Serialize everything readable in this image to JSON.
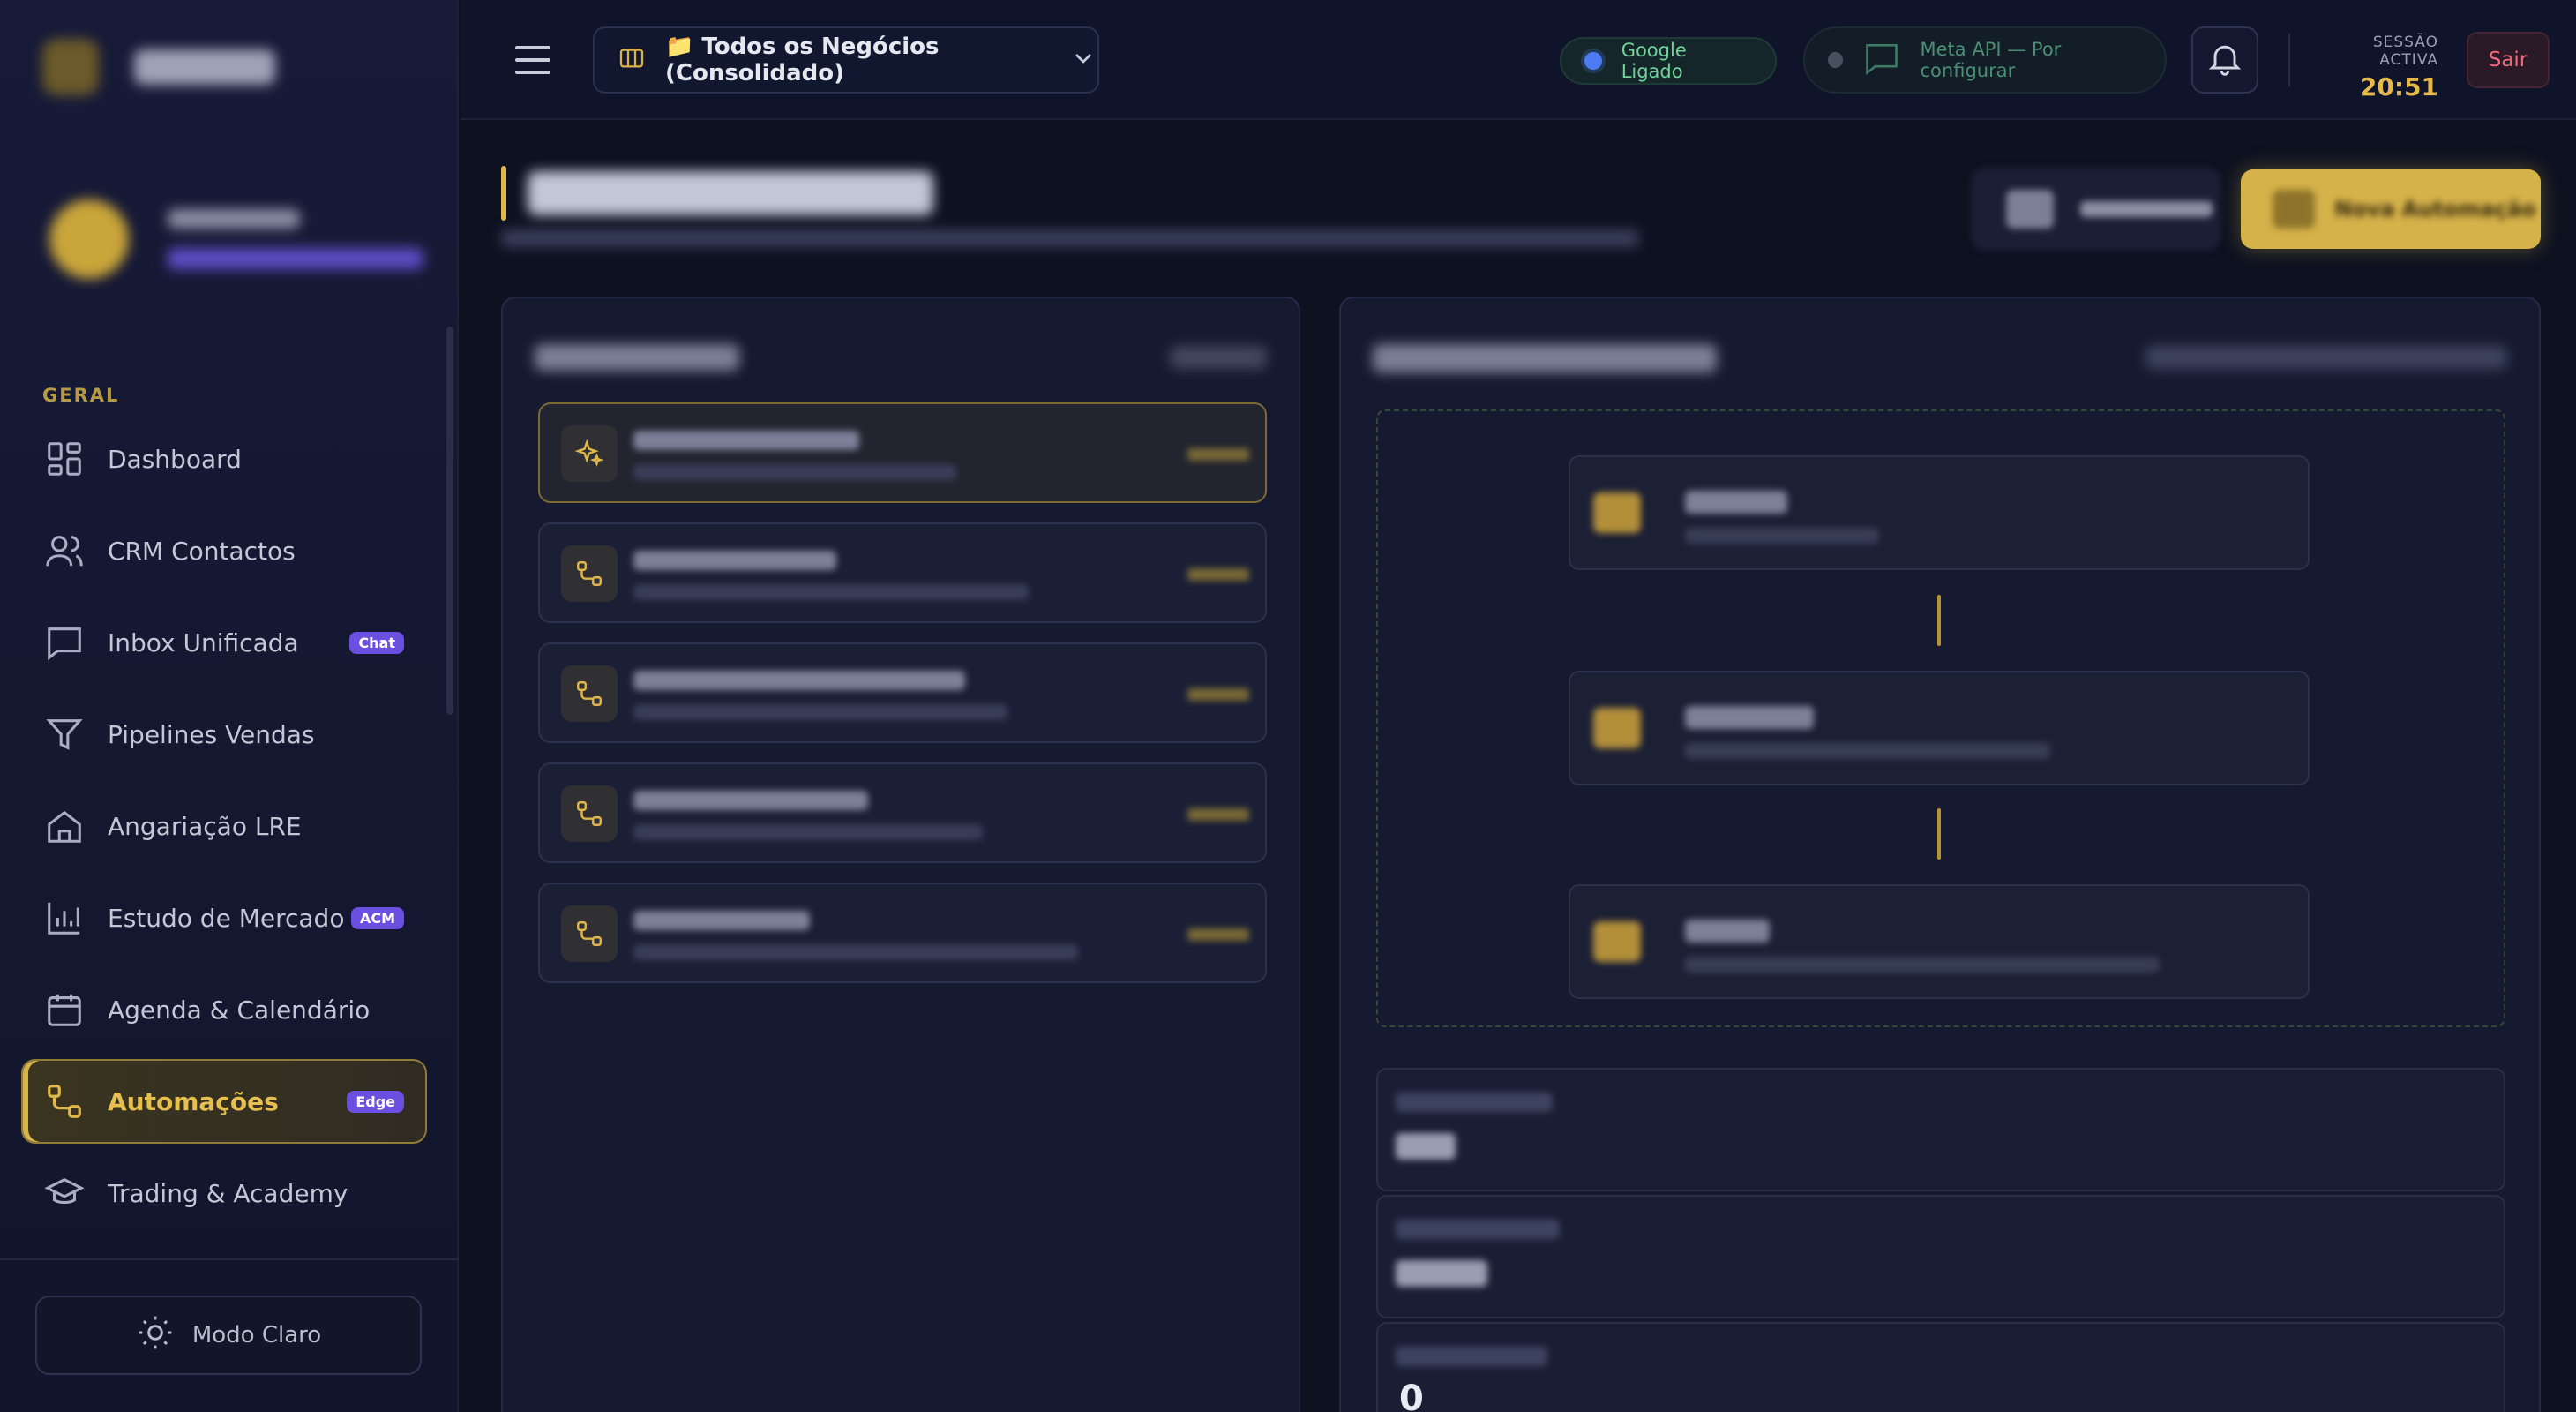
{
  "sidebar": {
    "section_label": "GERAL",
    "items": [
      {
        "label": "Dashboard",
        "icon": "grid-icon"
      },
      {
        "label": "CRM Contactos",
        "icon": "users-icon"
      },
      {
        "label": "Inbox Unificada",
        "icon": "chat-icon",
        "badge": "Chat"
      },
      {
        "label": "Pipelines Vendas",
        "icon": "funnel-icon"
      },
      {
        "label": "Angariação LRE",
        "icon": "house-icon"
      },
      {
        "label": "Estudo de Mercado",
        "icon": "bar-chart-icon",
        "badge": "ACM"
      },
      {
        "label": "Agenda & Calendário",
        "icon": "calendar-icon"
      },
      {
        "label": "Automações",
        "icon": "workflow-icon",
        "badge": "Edge",
        "active": true
      },
      {
        "label": "Trading & Academy",
        "icon": "graduation-cap-icon"
      }
    ],
    "theme_toggle_label": "Modo Claro"
  },
  "topbar": {
    "business_selector": "📁 Todos os Negócios (Consolidado)",
    "google_status": "Google Ligado",
    "meta_status": "Meta API — Por configurar",
    "session_label": "SESSÃO ACTIVA",
    "session_time": "20:51",
    "logout_label": "Sair"
  },
  "main": {
    "primary_button_label": "Nova Automação",
    "editor": {
      "last_field_value": "0"
    }
  },
  "colors": {
    "accent_gold": "#e0b84a",
    "badge_purple": "#6b4fe0",
    "google_green": "#6fd39a",
    "logout_red": "#f16a7a",
    "background": "#0d1120"
  }
}
